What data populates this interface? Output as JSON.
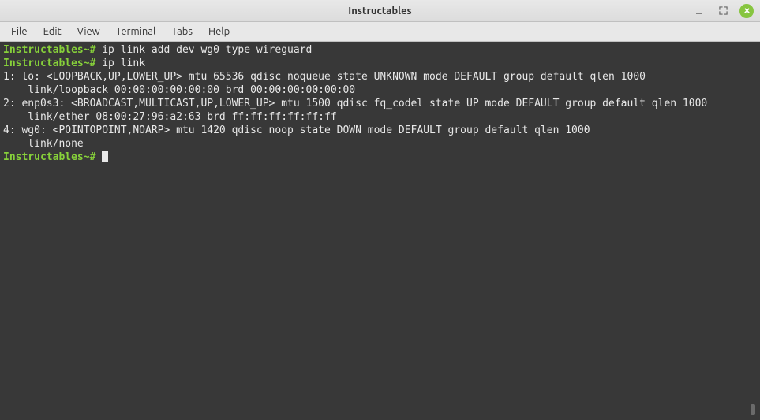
{
  "window": {
    "title": "Instructables"
  },
  "menu": {
    "file": "File",
    "edit": "Edit",
    "view": "View",
    "terminal": "Terminal",
    "tabs": "Tabs",
    "help": "Help"
  },
  "terminal": {
    "prompt": "Instructables~# ",
    "cmd1": "ip link add dev wg0 type wireguard",
    "cmd2": "ip link",
    "out1": "1: lo: <LOOPBACK,UP,LOWER_UP> mtu 65536 qdisc noqueue state UNKNOWN mode DEFAULT group default qlen 1000",
    "out2": "    link/loopback 00:00:00:00:00:00 brd 00:00:00:00:00:00",
    "out3": "2: enp0s3: <BROADCAST,MULTICAST,UP,LOWER_UP> mtu 1500 qdisc fq_codel state UP mode DEFAULT group default qlen 1000",
    "out4": "    link/ether 08:00:27:96:a2:63 brd ff:ff:ff:ff:ff:ff",
    "out5": "4: wg0: <POINTOPOINT,NOARP> mtu 1420 qdisc noop state DOWN mode DEFAULT group default qlen 1000",
    "out6": "    link/none"
  }
}
